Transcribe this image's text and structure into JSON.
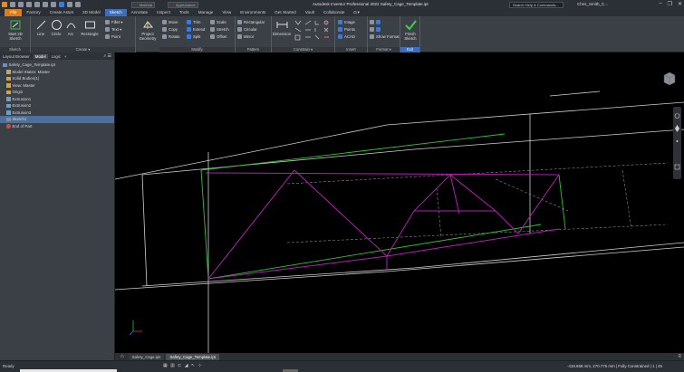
{
  "titlebar": {
    "app_title": "Autodesk Inventor Professional 2022   Safety_Cage_Template.ipt",
    "search_placeholder": "Search Help & Commands...",
    "user": "Chris_Smith_C...",
    "qa_dropdown_1": "Material",
    "qa_dropdown_2": "Appearance",
    "win_minimize": "–",
    "win_restore": "❐",
    "win_close": "✕"
  },
  "menubar": {
    "tabs": [
      "File",
      "Factory",
      "Create Asset",
      "3D Model",
      "Sketch",
      "Annotate",
      "Inspect",
      "Tools",
      "Manage",
      "View",
      "Environments",
      "Get Started",
      "Vault",
      "Collaborate",
      "◘ ▾"
    ],
    "active": "Sketch"
  },
  "ribbon": {
    "groups": {
      "sketch": "Sketch",
      "create": "Create ▾",
      "modify": "Modify",
      "pattern": "Pattern",
      "constrain": "Constrain ▾",
      "insert": "Insert",
      "format": "Format ▾",
      "exit": "Exit"
    },
    "buttons": {
      "start_sketch": "Start 2D Sketch",
      "line": "Line",
      "circle": "Circle",
      "arc": "Arc",
      "rectangle": "Rectangle",
      "fillet": "Fillet ▾",
      "text": "Text ▾",
      "point": "Point",
      "project_geometry": "Project Geometry",
      "move": "Move",
      "trim": "Trim",
      "scale": "Scale",
      "copy": "Copy",
      "extend": "Extend",
      "stretch": "Stretch",
      "rotate": "Rotate",
      "split": "Split",
      "offset": "Offset",
      "rectangular": "Rectangular",
      "circular": "Circular",
      "mirror": "Mirror",
      "dimension": "Dimension",
      "image": "Image",
      "points": "Points",
      "acad": "ACAD",
      "show_format": "Show Format",
      "finish_sketch": "Finish Sketch"
    }
  },
  "browser": {
    "tabs": [
      "Layout Browser",
      "Model",
      "Logic",
      "+"
    ],
    "active_tab": "Model",
    "tools": "⌕ ☰",
    "nodes": [
      {
        "label": "Safety_Cage_Template.ipt",
        "icon": "part",
        "indent": 0
      },
      {
        "label": "Model States: Master",
        "icon": "folder",
        "indent": 1
      },
      {
        "label": "Solid Bodies(1)",
        "icon": "folder",
        "indent": 1
      },
      {
        "label": "View: Master",
        "icon": "folder",
        "indent": 1
      },
      {
        "label": "Origin",
        "icon": "folder",
        "indent": 1
      },
      {
        "label": "Extrusion1",
        "icon": "feat",
        "indent": 1
      },
      {
        "label": "Extrusion2",
        "icon": "feat",
        "indent": 1
      },
      {
        "label": "Extrusion3",
        "icon": "feat",
        "indent": 1
      },
      {
        "label": "Sketch1",
        "icon": "sketch",
        "indent": 1,
        "selected": true
      },
      {
        "label": "End of Part",
        "icon": "eop",
        "indent": 1
      }
    ]
  },
  "doctabs": {
    "tabs": [
      "Safety_Cage.ipn",
      "Safety_Cage_Template.ipt"
    ],
    "active": "Safety_Cage_Template.ipt",
    "home_icon": "⌂"
  },
  "statusbar": {
    "ready": "Ready",
    "coords": "-418.658 mm, 270.776 mm  | Fully Constrained |  1   |  45"
  },
  "colors": {
    "accent_blue": "#3c6dbf",
    "file_orange": "#e07b1a",
    "sketch_magenta": "#b31fb3",
    "sketch_green": "#2fc42f",
    "edge_white": "#d0d0d0"
  }
}
